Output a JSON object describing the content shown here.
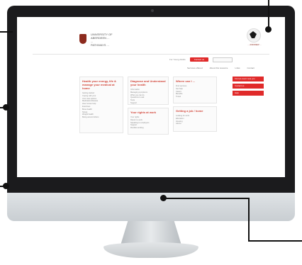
{
  "site": {
    "header_left_logo_text": "UNIVERSITY OF\nABERDEEN ...\n...\nPATHWAYS ...",
    "header_right_logo_text": "...\nANDREW ..."
  },
  "topbar": {
    "label": "For Young Adults",
    "button": "Contact us",
    "search_placeholder": ""
  },
  "nav": [
    "Services offered",
    "About this resource",
    "Links",
    "Contact"
  ],
  "columns": {
    "col1": {
      "title": "Health your energy, life & manage your medical at home",
      "items": [
        "Getting started",
        "Coping with your",
        "Your care options",
        "Medication/disease",
        "How nurses help",
        "Exercises",
        "Bone health",
        "Stress",
        "Weight health",
        "Being around others"
      ]
    },
    "col2": {
      "title": "Diagnose and Understand your health",
      "items": [
        "Information",
        "Managing symptoms",
        "What you can do",
        "Questions to ask",
        "Tests",
        "Support"
      ]
    },
    "col2b": {
      "title": "Your rights at work",
      "items": [
        "Your rights",
        "Return to work",
        "Speaking to employers",
        "Support",
        "Flexible working"
      ]
    },
    "col3": {
      "title": "Where can I ...",
      "items": [
        "Find services",
        "Get help",
        "Carers",
        "Benefits",
        "Travel"
      ]
    },
    "col3b": {
      "title": "Getting a job / home",
      "items": [
        "Looking for work",
        "Education",
        "Housing",
        "Advice"
      ]
    }
  },
  "red_tabs": [
    "Find an event near you",
    "Contact us",
    "Help"
  ]
}
